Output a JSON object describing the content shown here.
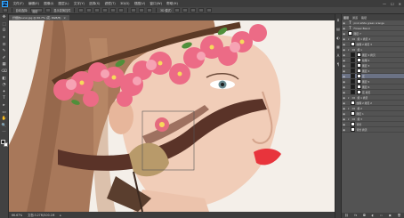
{
  "app": {
    "logo_text": "Ps"
  },
  "menu": [
    "文件(F)",
    "编辑(E)",
    "图像(I)",
    "图层(L)",
    "文字(Y)",
    "选择(S)",
    "滤镜(T)",
    "3D(D)",
    "视图(V)",
    "窗口(W)",
    "帮助(H)"
  ],
  "window_controls": [
    "—",
    "☐",
    "✕"
  ],
  "options_bar": {
    "auto_select_label": "自动选择:",
    "layer_dropdown": "图层",
    "transform_label": "显示变换控件",
    "mode_3d_label": "3D 模式:"
  },
  "document_tab": {
    "title": "纤细的sucai.jpg @ 66.7% (花, RGB/8)",
    "close": "×"
  },
  "status": {
    "zoom": "66.67%",
    "doc_size": "文档:3.27M/100.1M"
  },
  "panel": {
    "tabs": [
      "图层",
      "通道",
      "路径"
    ],
    "layers": [
      {
        "name": "pink white green orange",
        "type": "text",
        "eye": true,
        "indent": 0
      },
      {
        "name": "Flower Blend",
        "type": "text",
        "eye": true,
        "indent": 0
      },
      {
        "name": "图层 7",
        "type": "pixel",
        "eye": true,
        "indent": 0
      },
      {
        "name": "组 1 拷贝 2",
        "type": "group",
        "eye": true,
        "indent": 0
      },
      {
        "name": "纹理 2 拷贝 3",
        "type": "pixel",
        "eye": true,
        "indent": 1
      },
      {
        "name": "组 1",
        "type": "group",
        "eye": true,
        "indent": 0
      },
      {
        "name": "图层 2 拷贝",
        "type": "masked",
        "eye": true,
        "indent": 1
      },
      {
        "name": "纹理 2",
        "type": "masked",
        "eye": true,
        "indent": 1
      },
      {
        "name": "图层 3",
        "type": "masked",
        "eye": true,
        "indent": 1
      },
      {
        "name": "图层 4",
        "type": "masked",
        "eye": true,
        "indent": 1
      },
      {
        "name": "花",
        "type": "masked",
        "eye": true,
        "indent": 1,
        "selected": true
      },
      {
        "name": "图层 5",
        "type": "masked",
        "eye": true,
        "indent": 1
      },
      {
        "name": "图层 6",
        "type": "masked",
        "eye": true,
        "indent": 1
      },
      {
        "name": "花 拷贝",
        "type": "masked",
        "eye": true,
        "indent": 1
      },
      {
        "name": "组 1 拷贝",
        "type": "group",
        "eye": true,
        "indent": 0
      },
      {
        "name": "纹理 2 拷贝 2",
        "type": "pixel",
        "eye": true,
        "indent": 1
      },
      {
        "name": "组 2",
        "type": "group",
        "eye": true,
        "indent": 0
      },
      {
        "name": "图层 1",
        "type": "pixel",
        "eye": true,
        "indent": 1
      },
      {
        "name": "组 3",
        "type": "group",
        "eye": true,
        "indent": 0
      },
      {
        "name": "背景",
        "type": "pixel",
        "eye": true,
        "indent": 1
      },
      {
        "name": "背景 拷贝",
        "type": "pixel",
        "eye": true,
        "indent": 1
      }
    ],
    "footer_icons": [
      "link-icon",
      "fx-icon",
      "mask-icon",
      "adjustment-icon",
      "folder-icon",
      "new-layer-icon",
      "trash-icon"
    ],
    "footer_glyphs": [
      "⛓",
      "fx",
      "◘",
      "◐",
      "▭",
      "▣",
      "🗑"
    ]
  },
  "tools": [
    "✥",
    "⬚",
    "ʘ",
    "⌖",
    "⊡",
    "✎",
    "✐",
    "▦",
    "⌫",
    "◧",
    "◔",
    "✦",
    "T",
    "▸",
    "▭",
    "✋",
    "🔍",
    "⋯"
  ],
  "colors": {
    "accent": "#31a8ff",
    "flower_pink": "#ec6b86",
    "ribbon": "#5a3328"
  }
}
